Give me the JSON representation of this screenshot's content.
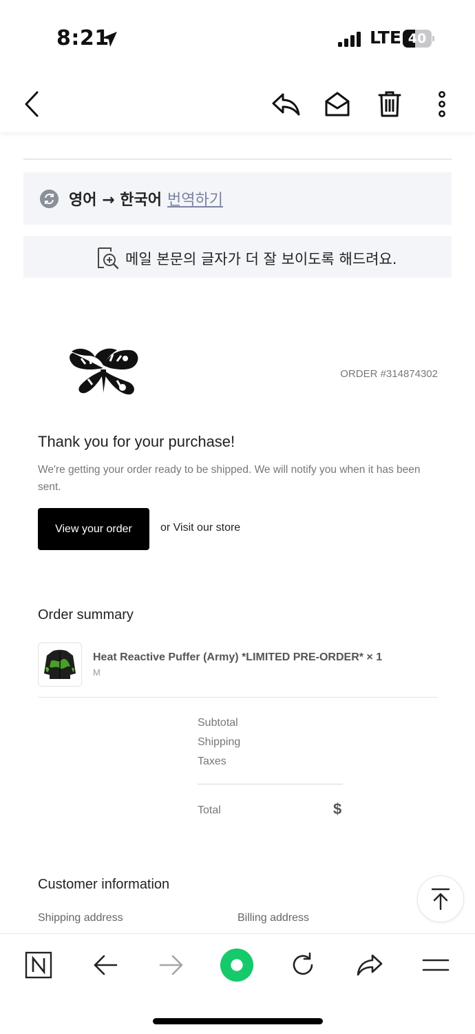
{
  "status_bar": {
    "time": "8:21",
    "network": "LTE",
    "battery": "40"
  },
  "translate": {
    "direction": "영어 → 한국어",
    "action": "번역하기"
  },
  "readability": {
    "text": "메일 본문의 글자가 더 잘 보이도록 해드려요."
  },
  "email": {
    "order_number": "ORDER #314874302",
    "thanks_title": "Thank you for your purchase!",
    "thanks_body": "We're getting your order ready to be shipped. We will notify you when it has been sent.",
    "view_order_button": "View your order",
    "visit_store": "or Visit our store",
    "order_summary": {
      "title": "Order summary",
      "product_name": "Heat Reactive Puffer (Army) *LIMITED PRE-ORDER* × 1",
      "product_variant": "M",
      "subtotal_label": "Subtotal",
      "shipping_label": "Shipping",
      "taxes_label": "Taxes",
      "total_label": "Total",
      "total_value": "$"
    },
    "customer_info": {
      "title": "Customer information",
      "shipping_address_label": "Shipping address",
      "billing_address_label": "Billing address"
    }
  },
  "colors": {
    "accent_green": "#16c96a",
    "panel_bg": "#f4f5f8",
    "link": "#7a82a0"
  },
  "icons": [
    "location-arrow-icon",
    "signal-icon",
    "back-chevron-icon",
    "reply-icon",
    "mail-open-icon",
    "trash-icon",
    "more-vertical-icon",
    "translate-icon",
    "zoom-doc-icon",
    "scroll-top-icon",
    "naver-n-icon",
    "back-arrow-icon",
    "forward-arrow-icon",
    "naver-green-icon",
    "refresh-icon",
    "share-icon",
    "menu-icon"
  ]
}
